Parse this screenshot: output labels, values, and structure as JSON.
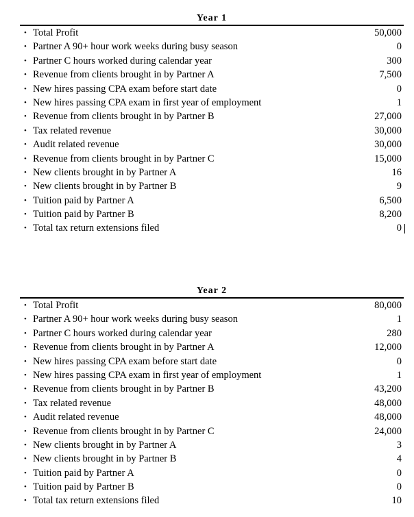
{
  "sections": [
    {
      "title": "Year 1",
      "rows": [
        {
          "label": "Total Profit",
          "value": "50,000"
        },
        {
          "label": "Partner A 90+ hour work weeks during busy season",
          "value": "0"
        },
        {
          "label": "Partner C hours worked during calendar year",
          "value": "300"
        },
        {
          "label": "Revenue from clients brought in by Partner A",
          "value": "7,500"
        },
        {
          "label": "New hires passing CPA exam before start date",
          "value": "0"
        },
        {
          "label": "New hires passing CPA exam in first year of employment",
          "value": "1"
        },
        {
          "label": "Revenue from clients brought in by Partner B",
          "value": "27,000"
        },
        {
          "label": "Tax related revenue",
          "value": "30,000"
        },
        {
          "label": "Audit related revenue",
          "value": "30,000"
        },
        {
          "label": "Revenue from clients brought in by Partner C",
          "value": "15,000"
        },
        {
          "label": "New clients brought in by Partner A",
          "value": "16"
        },
        {
          "label": "New clients brought in by Partner B",
          "value": "9"
        },
        {
          "label": "Tuition paid by Partner A",
          "value": "6,500"
        },
        {
          "label": "Tuition paid by Partner B",
          "value": "8,200"
        },
        {
          "label": "Total tax return extensions filed",
          "value": "0"
        }
      ]
    },
    {
      "title": "Year 2",
      "rows": [
        {
          "label": "Total Profit",
          "value": "80,000"
        },
        {
          "label": "Partner A 90+ hour work weeks during busy season",
          "value": "1"
        },
        {
          "label": "Partner C hours worked during calendar year",
          "value": "280"
        },
        {
          "label": "Revenue from clients brought in by Partner A",
          "value": "12,000"
        },
        {
          "label": "New hires passing CPA exam before start date",
          "value": "0"
        },
        {
          "label": "New hires passing CPA exam in first year of employment",
          "value": "1"
        },
        {
          "label": "Revenue from clients brought in by Partner B",
          "value": "43,200"
        },
        {
          "label": "Tax related revenue",
          "value": "48,000"
        },
        {
          "label": "Audit related revenue",
          "value": "48,000"
        },
        {
          "label": "Revenue from clients brought in by Partner C",
          "value": "24,000"
        },
        {
          "label": "New clients brought in by Partner A",
          "value": "3"
        },
        {
          "label": "New clients brought in by Partner B",
          "value": "4"
        },
        {
          "label": "Tuition paid by Partner A",
          "value": "0"
        },
        {
          "label": "Tuition paid by Partner B",
          "value": "0"
        },
        {
          "label": "Total tax return extensions filed",
          "value": "10"
        }
      ]
    }
  ],
  "bullet_glyph": "•"
}
